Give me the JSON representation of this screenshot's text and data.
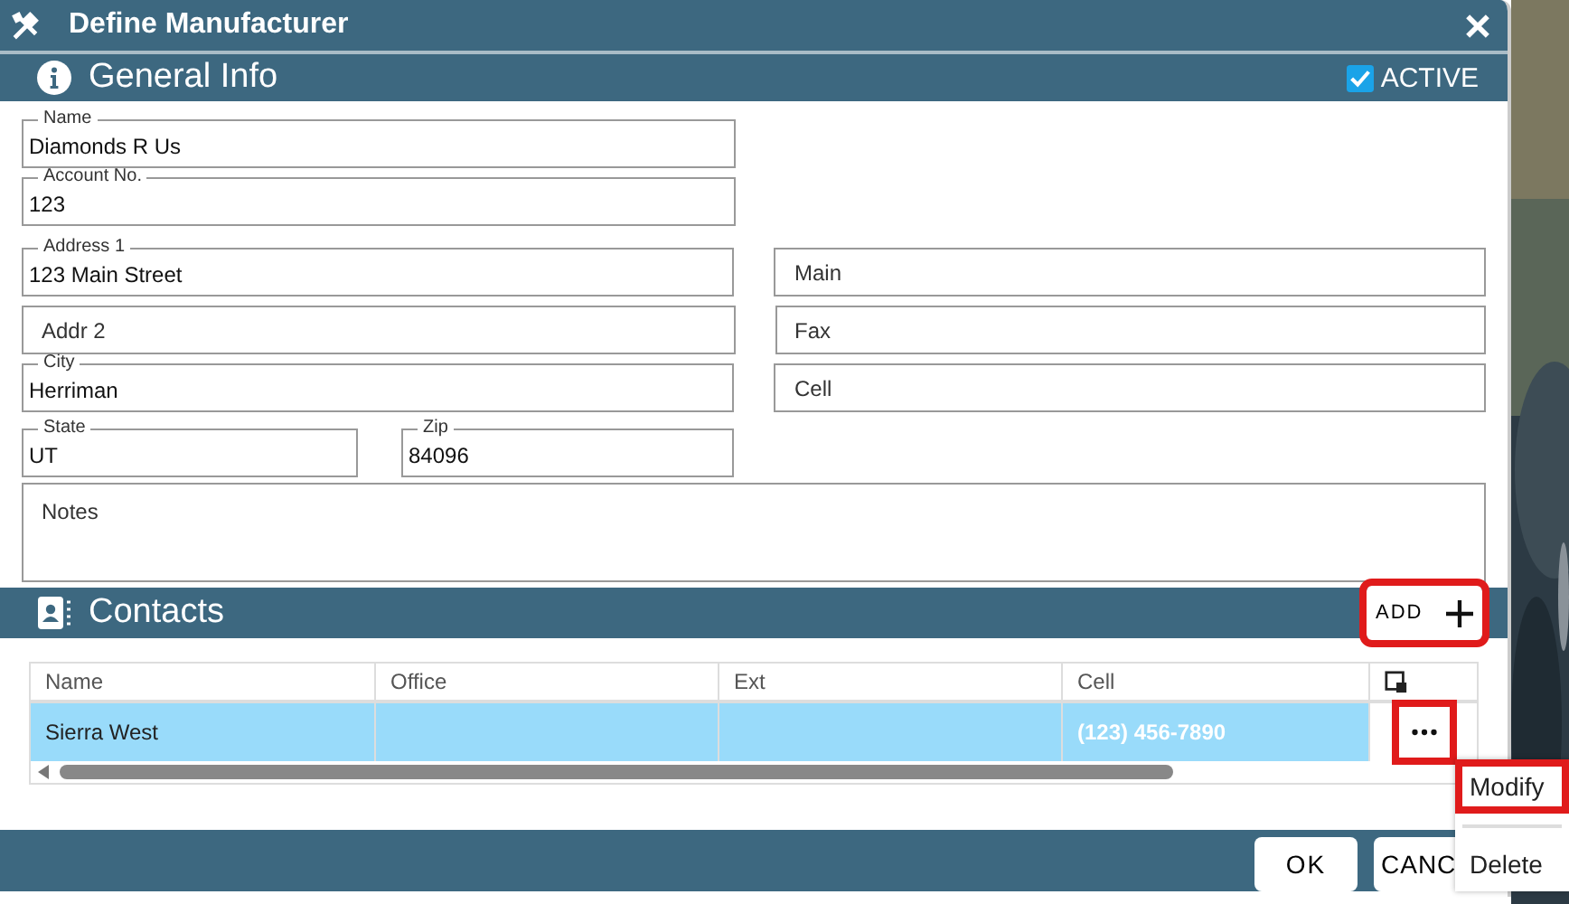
{
  "window": {
    "title": "Define Manufacturer"
  },
  "general_info": {
    "title": "General Info",
    "active": {
      "label": "ACTIVE",
      "checked": true
    }
  },
  "fields": {
    "name": {
      "label": "Name",
      "value": "Diamonds R Us"
    },
    "account_no": {
      "label": "Account No.",
      "value": "123"
    },
    "address_1": {
      "label": "Address 1",
      "value": "123 Main Street"
    },
    "main_phone": {
      "placeholder": "Main"
    },
    "address_2": {
      "placeholder": "Addr 2"
    },
    "fax": {
      "placeholder": "Fax"
    },
    "city": {
      "label": "City",
      "value": "Herriman"
    },
    "cell": {
      "placeholder": "Cell"
    },
    "state": {
      "label": "State",
      "value": "UT"
    },
    "zip": {
      "label": "Zip",
      "value": "84096"
    },
    "notes": {
      "placeholder": "Notes"
    }
  },
  "contacts": {
    "title": "Contacts",
    "add_button": {
      "label": "ADD",
      "highlighted": true
    },
    "columns": [
      "Name",
      "Office",
      "Ext",
      "Cell"
    ],
    "rows": [
      {
        "name": "Sierra West",
        "cell": "(123) 456-7890",
        "selected": true,
        "actions_highlighted": true
      }
    ]
  },
  "footer": {
    "buttons": [
      "OK",
      "CANC"
    ]
  },
  "context_menu": {
    "items": [
      {
        "label": "Modify",
        "highlighted": true
      },
      {
        "label": "Delete",
        "highlighted": false
      }
    ]
  }
}
